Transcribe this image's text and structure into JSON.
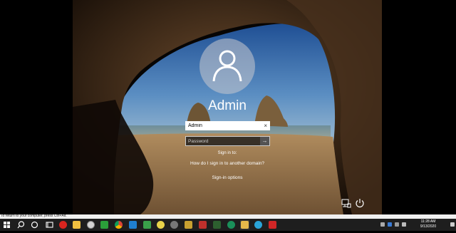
{
  "lock_screen": {
    "user_name": "Admin",
    "username_value": "Admin",
    "password_placeholder": "Password",
    "sign_in_to": "Sign in to:",
    "other_domain_link": "How do I sign in to another domain?",
    "signin_options": "Sign-in options"
  },
  "status_bar": {
    "text": "To return to your computer, press Ctrl+Alt."
  },
  "taskbar": {
    "clock_time": "11:28 AM",
    "clock_date": "9/13/2020",
    "apps": [
      "start-button",
      "search-icon",
      "task-view-icon",
      "opera-icon",
      "file-explorer-icon",
      "chrome-icon",
      "app-3-icon",
      "app-green-icon",
      "windows-store-icon",
      "app-yellow-icon",
      "settings-icon",
      "app-dark-icon",
      "notes-icon",
      "tools-icon",
      "app-red-icon",
      "edge-icon",
      "app-gray-icon",
      "remote-desktop-icon",
      "app-red-square-icon"
    ]
  },
  "colors": {
    "taskbar_bg": "#1e1e1e",
    "status_bar_bg": "#f0f0f0",
    "accent_red": "#d02626"
  }
}
